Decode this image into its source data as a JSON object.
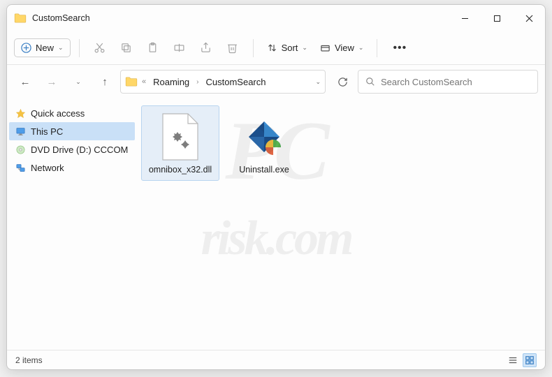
{
  "window": {
    "title": "CustomSearch"
  },
  "toolbar": {
    "new_label": "New",
    "sort_label": "Sort",
    "view_label": "View"
  },
  "breadcrumb": {
    "parts": [
      "Roaming",
      "CustomSearch"
    ]
  },
  "search": {
    "placeholder": "Search CustomSearch"
  },
  "sidebar": {
    "items": [
      {
        "label": "Quick access"
      },
      {
        "label": "This PC"
      },
      {
        "label": "DVD Drive (D:) CCCOM"
      },
      {
        "label": "Network"
      }
    ]
  },
  "files": [
    {
      "name": "omnibox_x32.dll"
    },
    {
      "name": "Uninstall.exe"
    }
  ],
  "status": {
    "item_count": "2 items"
  },
  "watermark": "PC\nrisk.com"
}
